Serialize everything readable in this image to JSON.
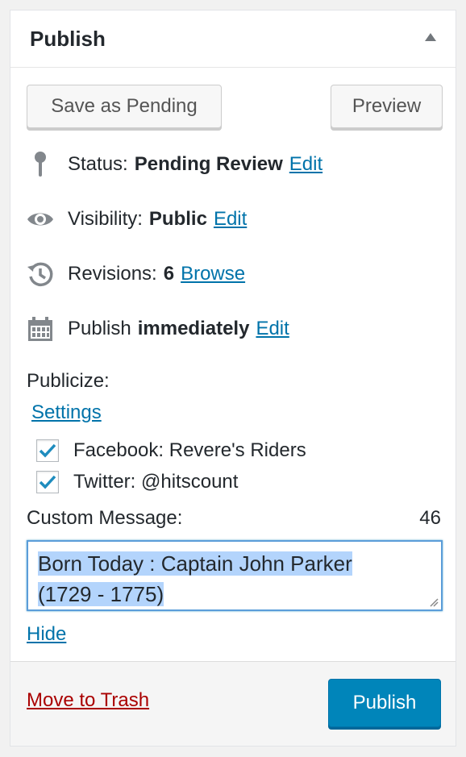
{
  "panel": {
    "title": "Publish"
  },
  "actions": {
    "save_pending": "Save as Pending",
    "preview": "Preview"
  },
  "status": {
    "label": "Status:",
    "value": "Pending Review",
    "edit": "Edit"
  },
  "visibility": {
    "label": "Visibility:",
    "value": "Public",
    "edit": "Edit"
  },
  "revisions": {
    "label": "Revisions:",
    "count": "6",
    "browse": "Browse"
  },
  "schedule": {
    "label": "Publish",
    "value": "immediately",
    "edit": "Edit"
  },
  "publicize": {
    "label": "Publicize:",
    "settings": "Settings",
    "connections": [
      {
        "label": "Facebook: Revere's Riders",
        "checked": true
      },
      {
        "label": "Twitter: @hitscount",
        "checked": true
      }
    ],
    "custom_message_label": "Custom Message:",
    "char_count": "46",
    "message_line1": "Born Today : Captain John Parker",
    "message_line2": "(1729 - 1775)",
    "hide": "Hide"
  },
  "footer": {
    "trash": "Move to Trash",
    "publish": "Publish"
  },
  "colors": {
    "link": "#0073aa",
    "primary": "#0085ba",
    "danger": "#a00",
    "selection": "#b3d4fc"
  }
}
